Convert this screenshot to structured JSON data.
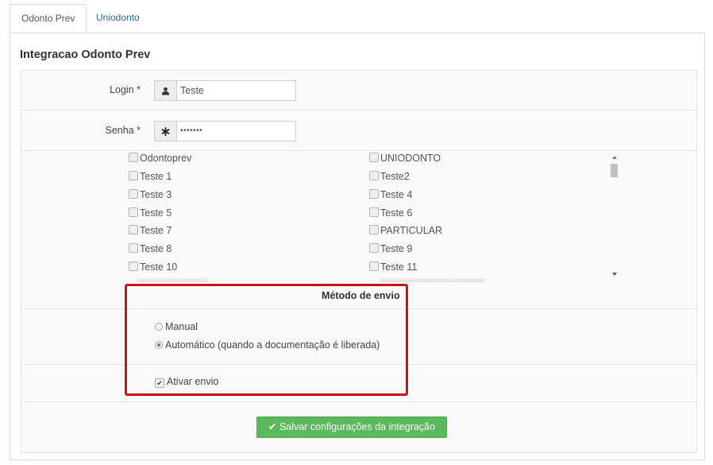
{
  "tabs": [
    {
      "label": "Odonto Prev",
      "active": true
    },
    {
      "label": "Uniodonto",
      "active": false
    }
  ],
  "panel_title": "Integracao Odonto Prev",
  "login": {
    "label": "Login *",
    "value": "Teste",
    "icon": "user-icon"
  },
  "senha": {
    "label": "Senha *",
    "value": "•••••••",
    "icon": "asterisk-icon"
  },
  "checkboxes": {
    "left": [
      {
        "label": "Odontoprev",
        "checked": false
      },
      {
        "label": "Teste 1",
        "checked": false
      },
      {
        "label": "Teste 3",
        "checked": false
      },
      {
        "label": "Teste 5",
        "checked": false
      },
      {
        "label": "Teste 7",
        "checked": false
      },
      {
        "label": "Teste 8",
        "checked": false
      },
      {
        "label": "Teste 10",
        "checked": false
      }
    ],
    "right": [
      {
        "label": "UNIODONTO",
        "checked": false
      },
      {
        "label": "Teste2",
        "checked": false
      },
      {
        "label": "Teste 4",
        "checked": false
      },
      {
        "label": "Teste 6",
        "checked": false
      },
      {
        "label": "PARTICULAR",
        "checked": false
      },
      {
        "label": "Teste 9",
        "checked": false
      },
      {
        "label": "Teste 11",
        "checked": false
      }
    ]
  },
  "metodo": {
    "heading": "Método de envio",
    "options": [
      {
        "label": "Manual",
        "selected": false
      },
      {
        "label": "Automático (quando a documentação é liberada)",
        "selected": true
      }
    ]
  },
  "ativar_envio": {
    "label": "Ativar envio",
    "checked": true
  },
  "save_button": {
    "label": "Salvar configurações da integração",
    "icon": "check-icon"
  },
  "colors": {
    "accent_tab": "#2f6a99",
    "button_green": "#5cb85c",
    "highlight_red": "#c4161c"
  }
}
